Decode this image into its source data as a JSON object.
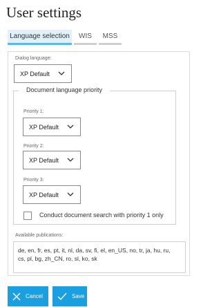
{
  "header": {
    "title": "User settings"
  },
  "tabs": [
    {
      "label": "Language selection"
    },
    {
      "label": "WIS"
    },
    {
      "label": "MSS"
    }
  ],
  "dialog_language": {
    "label": "Dialog language:",
    "value": "XP Default"
  },
  "document_priority": {
    "legend": "Document language priority",
    "priorities": [
      {
        "label": "Priority 1:",
        "value": "XP Default"
      },
      {
        "label": "Priority 2:",
        "value": "XP Default"
      },
      {
        "label": "Priority 3:",
        "value": "XP Default"
      }
    ],
    "checkbox_label": "Conduct document search with priority 1 only"
  },
  "publications": {
    "label": "Available publications:",
    "line1": "de, en, fr, es, pt, it, nl, da, sv, fi, el, en_US, no, tr, ja, hu, ru,",
    "line2": "cs, pl, bg, zh_CN, ro, sl, ko, sk"
  },
  "footer": {
    "cancel_label": "Cancel",
    "save_label": "Save"
  },
  "colors": {
    "accent": "#1aa0e0",
    "tab_active_bg": "#dff1f9",
    "tab_active_underline": "#5bb9e2"
  }
}
